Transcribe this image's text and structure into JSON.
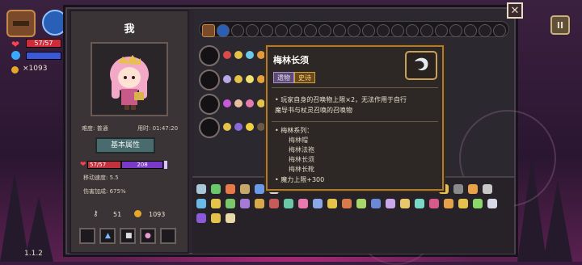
{
  "hud": {
    "hp_text": "57/57",
    "coins": "×1093",
    "version": "1.1.2"
  },
  "character": {
    "name": "我",
    "difficulty": "难度: 普通",
    "time": "用时: 01:47:20",
    "attr_button": "基本属性",
    "hp": "57/57",
    "mana": "208",
    "move_speed": "移动速度: 5.5",
    "damage_bonus": "伤害加成: 675%",
    "keys": "51",
    "gold": "1093"
  },
  "tooltip": {
    "title": "梅林长须",
    "tag_type": "遗物",
    "tag_rarity": "史诗",
    "desc_line1": "• 玩家自身的召唤物上限×2，无法作用于自行",
    "desc_line2": "魔导书与杖灵召唤的召唤物",
    "set_title": "• 梅林系列：",
    "set_items": [
      "梅林帽",
      "梅林法袍",
      "梅林长须",
      "梅林长靴"
    ],
    "bonus": "• 魔力上限+300"
  },
  "buttons": {
    "close": "✕",
    "pause": "II"
  },
  "colors": {
    "panel": "#2c2530",
    "tooltip_border": "#b07a30",
    "rarity_epic": "#ffd27a",
    "hp_red": "#c2313e",
    "mana_purple": "#7a3ac8"
  }
}
